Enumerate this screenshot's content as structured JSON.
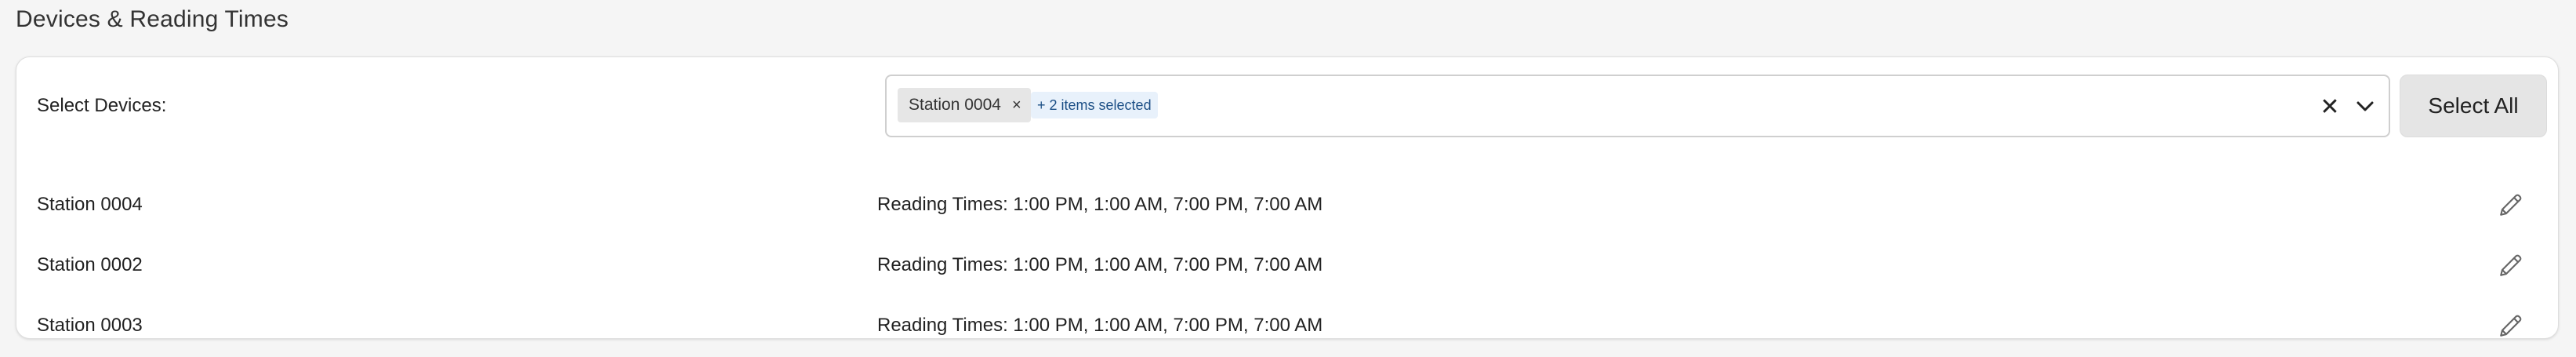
{
  "page": {
    "title": "Devices & Reading Times"
  },
  "device_select": {
    "label": "Select Devices:",
    "chips": [
      {
        "label": "Station 0004",
        "remove_glyph": "×"
      }
    ],
    "more_badge": "+ 2 items selected",
    "clear_glyph": "✕",
    "select_all_label": "Select All"
  },
  "devices": [
    {
      "name": "Station 0004",
      "reading_times": "Reading Times: 1:00 PM, 1:00 AM, 7:00 PM, 7:00 AM"
    },
    {
      "name": "Station 0002",
      "reading_times": "Reading Times: 1:00 PM, 1:00 AM, 7:00 PM, 7:00 AM"
    },
    {
      "name": "Station 0003",
      "reading_times": "Reading Times: 1:00 PM, 1:00 AM, 7:00 PM, 7:00 AM"
    }
  ],
  "icons": {
    "edit": "pencil-icon",
    "dropdown": "chevron-down-icon",
    "clear": "close-icon"
  }
}
